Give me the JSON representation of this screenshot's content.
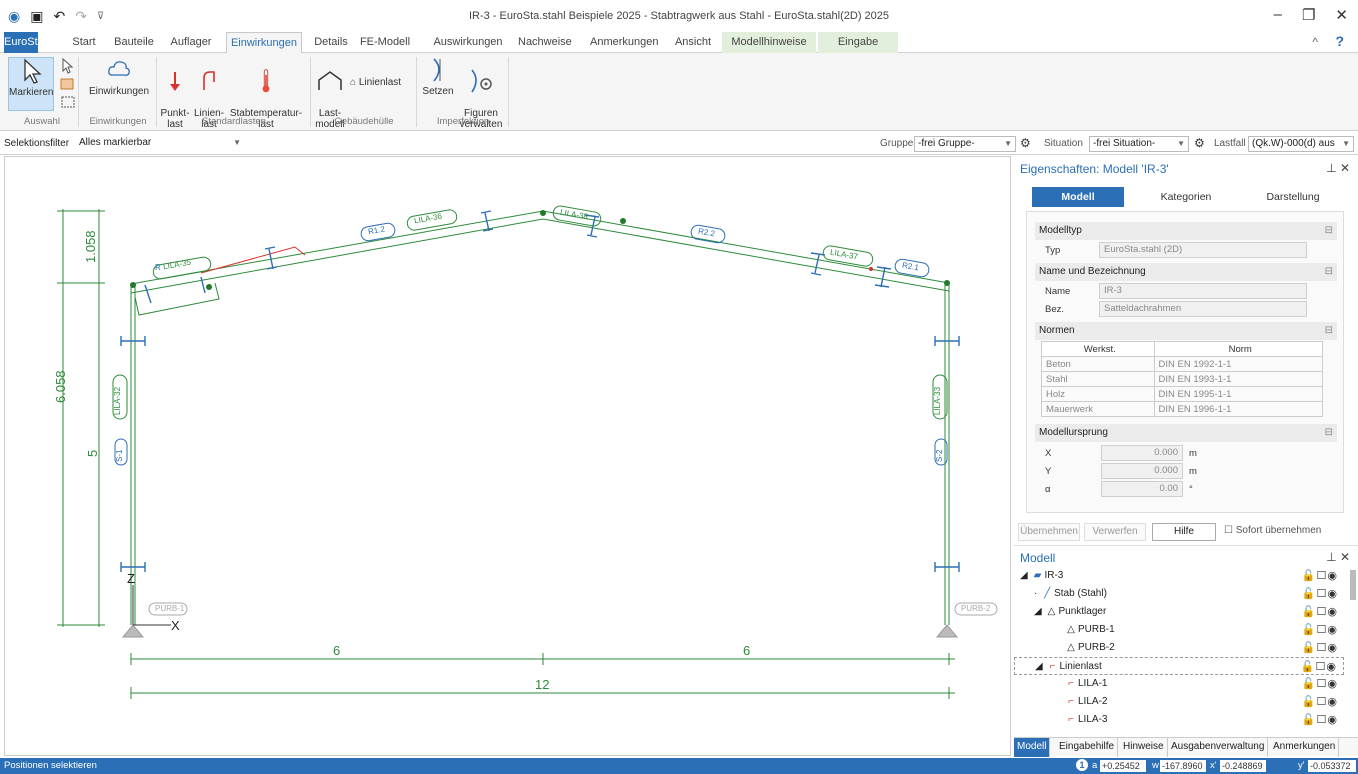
{
  "window": {
    "title": "IR-3 - EuroSta.stahl Beispiele 2025 - Stabtragwerk aus Stahl - EuroSta.stahl(2D) 2025",
    "qat_icons": [
      "app-logo-icon",
      "save-icon",
      "undo-icon",
      "redo-icon",
      "customize-icon"
    ],
    "controls": {
      "minimize": "–",
      "restore": "❐",
      "close": "✕",
      "collapse": "^",
      "help": "?"
    }
  },
  "tabs": [
    "EuroSta",
    "Start",
    "Bauteile",
    "Auflager",
    "Einwirkungen",
    "Details",
    "FE-Modell",
    "Auswirkungen",
    "Nachweise",
    "Anmerkungen",
    "Ansicht",
    "Modellhinweise",
    "Eingabe"
  ],
  "ribbon": {
    "markieren": "Markieren",
    "einwirkungen": "Einwirkungen",
    "punktlast": "Punkt-\nlast",
    "linienlast": "Linien-\nlast",
    "stabtemp": "Stabtemperatur-\nlast",
    "lastmodell": "Last-\nmodell",
    "linienlast2": "Linienlast",
    "setzen": "Setzen",
    "figuren": "Figuren\nverwalten",
    "groups": [
      "Auswahl",
      "Einwirkungen",
      "Standardlasten",
      "Gebäudehülle",
      "Imperfektion"
    ]
  },
  "filterbar": {
    "sel_label": "Selektionsfilter",
    "sel_value": "Alles markierbar",
    "gruppe_label": "Gruppe",
    "gruppe_value": "-frei Gruppe-",
    "situation_label": "Situation",
    "situation_value": "-frei Situation-",
    "lastfall_label": "Lastfall",
    "lastfall_value": "(Qk.W)-000(d) aus"
  },
  "props": {
    "title": "Eigenschaften: Modell 'IR-3'",
    "tabs": [
      "Modell",
      "Kategorien",
      "Darstellung"
    ],
    "sec_modelltyp": "Modelltyp",
    "typ_label": "Typ",
    "typ_value": "EuroSta.stahl (2D)",
    "sec_name": "Name und Bezeichnung",
    "name_label": "Name",
    "name_value": "IR-3",
    "bez_label": "Bez.",
    "bez_value": "Satteldachrahmen",
    "sec_normen": "Normen",
    "normen_head": [
      "Werkst.",
      "Norm"
    ],
    "normen_rows": [
      [
        "Beton",
        "DIN EN 1992-1-1"
      ],
      [
        "Stahl",
        "DIN EN 1993-1-1"
      ],
      [
        "Holz",
        "DIN EN 1995-1-1"
      ],
      [
        "Mauerwerk",
        "DIN EN 1996-1-1"
      ]
    ],
    "sec_ursprung": "Modellursprung",
    "x_label": "X",
    "x_value": "0.000",
    "x_unit": "m",
    "y_label": "Y",
    "y_value": "0.000",
    "y_unit": "m",
    "a_label": "α",
    "a_value": "0.00",
    "a_unit": "°",
    "btn_uebernehmen": "Übernehmen",
    "btn_verwerfen": "Verwerfen",
    "btn_hilfe": "Hilfe",
    "chk_sofort": "Sofort übernehmen"
  },
  "tree": {
    "title": "Modell",
    "items": [
      {
        "label": "IR-3",
        "icon": "folder-icon"
      },
      {
        "label": "Stab (Stahl)",
        "icon": "beam-icon"
      },
      {
        "label": "Punktlager",
        "icon": "support-icon"
      },
      {
        "label": "PURB-1",
        "icon": "support-icon"
      },
      {
        "label": "PURB-2",
        "icon": "support-icon"
      },
      {
        "label": "Linienlast",
        "icon": "line-load-icon"
      },
      {
        "label": "LILA-1",
        "icon": "line-load-icon"
      },
      {
        "label": "LILA-2",
        "icon": "line-load-icon"
      },
      {
        "label": "LILA-3",
        "icon": "line-load-icon"
      }
    ]
  },
  "bottom_tabs": [
    "Modell",
    "Eingabehilfe",
    "Hinweise",
    "Ausgabenverwaltung",
    "Anmerkungen"
  ],
  "status": {
    "text": "Positionen selektieren",
    "a_label": "a",
    "a_value": "+0.25452",
    "w_label": "w",
    "w_value": "-167.8960",
    "x_label": "x'",
    "x_value": "-0.248869",
    "y_label": "y'",
    "y_value": "-0.053372"
  },
  "drawing": {
    "dim_total_height": "6.058",
    "dim_ridge": "1.058",
    "dim_column": "5",
    "dim_half_left": "6",
    "dim_half_right": "6",
    "dim_span": "12",
    "axis_z": "Z",
    "axis_x": "X",
    "tags": [
      "LILA-32",
      "S-1",
      "LILA-33",
      "S-2",
      "LILA-35",
      "LILA-36",
      "LILA-38",
      "LILA-37",
      "R1.2",
      "R2.2",
      "R2.1",
      "R",
      "PURB-1",
      "PURB-2"
    ]
  }
}
